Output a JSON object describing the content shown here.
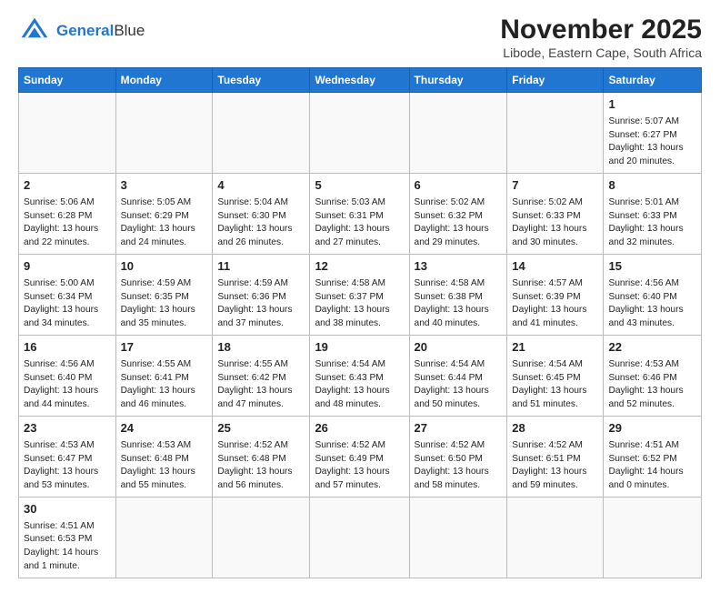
{
  "header": {
    "logo_line1": "General",
    "logo_line2": "Blue",
    "title": "November 2025",
    "subtitle": "Libode, Eastern Cape, South Africa"
  },
  "days_of_week": [
    "Sunday",
    "Monday",
    "Tuesday",
    "Wednesday",
    "Thursday",
    "Friday",
    "Saturday"
  ],
  "weeks": [
    [
      {
        "day": "",
        "info": ""
      },
      {
        "day": "",
        "info": ""
      },
      {
        "day": "",
        "info": ""
      },
      {
        "day": "",
        "info": ""
      },
      {
        "day": "",
        "info": ""
      },
      {
        "day": "",
        "info": ""
      },
      {
        "day": "1",
        "info": "Sunrise: 5:07 AM\nSunset: 6:27 PM\nDaylight: 13 hours and 20 minutes."
      }
    ],
    [
      {
        "day": "2",
        "info": "Sunrise: 5:06 AM\nSunset: 6:28 PM\nDaylight: 13 hours and 22 minutes."
      },
      {
        "day": "3",
        "info": "Sunrise: 5:05 AM\nSunset: 6:29 PM\nDaylight: 13 hours and 24 minutes."
      },
      {
        "day": "4",
        "info": "Sunrise: 5:04 AM\nSunset: 6:30 PM\nDaylight: 13 hours and 26 minutes."
      },
      {
        "day": "5",
        "info": "Sunrise: 5:03 AM\nSunset: 6:31 PM\nDaylight: 13 hours and 27 minutes."
      },
      {
        "day": "6",
        "info": "Sunrise: 5:02 AM\nSunset: 6:32 PM\nDaylight: 13 hours and 29 minutes."
      },
      {
        "day": "7",
        "info": "Sunrise: 5:02 AM\nSunset: 6:33 PM\nDaylight: 13 hours and 30 minutes."
      },
      {
        "day": "8",
        "info": "Sunrise: 5:01 AM\nSunset: 6:33 PM\nDaylight: 13 hours and 32 minutes."
      }
    ],
    [
      {
        "day": "9",
        "info": "Sunrise: 5:00 AM\nSunset: 6:34 PM\nDaylight: 13 hours and 34 minutes."
      },
      {
        "day": "10",
        "info": "Sunrise: 4:59 AM\nSunset: 6:35 PM\nDaylight: 13 hours and 35 minutes."
      },
      {
        "day": "11",
        "info": "Sunrise: 4:59 AM\nSunset: 6:36 PM\nDaylight: 13 hours and 37 minutes."
      },
      {
        "day": "12",
        "info": "Sunrise: 4:58 AM\nSunset: 6:37 PM\nDaylight: 13 hours and 38 minutes."
      },
      {
        "day": "13",
        "info": "Sunrise: 4:58 AM\nSunset: 6:38 PM\nDaylight: 13 hours and 40 minutes."
      },
      {
        "day": "14",
        "info": "Sunrise: 4:57 AM\nSunset: 6:39 PM\nDaylight: 13 hours and 41 minutes."
      },
      {
        "day": "15",
        "info": "Sunrise: 4:56 AM\nSunset: 6:40 PM\nDaylight: 13 hours and 43 minutes."
      }
    ],
    [
      {
        "day": "16",
        "info": "Sunrise: 4:56 AM\nSunset: 6:40 PM\nDaylight: 13 hours and 44 minutes."
      },
      {
        "day": "17",
        "info": "Sunrise: 4:55 AM\nSunset: 6:41 PM\nDaylight: 13 hours and 46 minutes."
      },
      {
        "day": "18",
        "info": "Sunrise: 4:55 AM\nSunset: 6:42 PM\nDaylight: 13 hours and 47 minutes."
      },
      {
        "day": "19",
        "info": "Sunrise: 4:54 AM\nSunset: 6:43 PM\nDaylight: 13 hours and 48 minutes."
      },
      {
        "day": "20",
        "info": "Sunrise: 4:54 AM\nSunset: 6:44 PM\nDaylight: 13 hours and 50 minutes."
      },
      {
        "day": "21",
        "info": "Sunrise: 4:54 AM\nSunset: 6:45 PM\nDaylight: 13 hours and 51 minutes."
      },
      {
        "day": "22",
        "info": "Sunrise: 4:53 AM\nSunset: 6:46 PM\nDaylight: 13 hours and 52 minutes."
      }
    ],
    [
      {
        "day": "23",
        "info": "Sunrise: 4:53 AM\nSunset: 6:47 PM\nDaylight: 13 hours and 53 minutes."
      },
      {
        "day": "24",
        "info": "Sunrise: 4:53 AM\nSunset: 6:48 PM\nDaylight: 13 hours and 55 minutes."
      },
      {
        "day": "25",
        "info": "Sunrise: 4:52 AM\nSunset: 6:48 PM\nDaylight: 13 hours and 56 minutes."
      },
      {
        "day": "26",
        "info": "Sunrise: 4:52 AM\nSunset: 6:49 PM\nDaylight: 13 hours and 57 minutes."
      },
      {
        "day": "27",
        "info": "Sunrise: 4:52 AM\nSunset: 6:50 PM\nDaylight: 13 hours and 58 minutes."
      },
      {
        "day": "28",
        "info": "Sunrise: 4:52 AM\nSunset: 6:51 PM\nDaylight: 13 hours and 59 minutes."
      },
      {
        "day": "29",
        "info": "Sunrise: 4:51 AM\nSunset: 6:52 PM\nDaylight: 14 hours and 0 minutes."
      }
    ],
    [
      {
        "day": "30",
        "info": "Sunrise: 4:51 AM\nSunset: 6:53 PM\nDaylight: 14 hours and 1 minute."
      },
      {
        "day": "",
        "info": ""
      },
      {
        "day": "",
        "info": ""
      },
      {
        "day": "",
        "info": ""
      },
      {
        "day": "",
        "info": ""
      },
      {
        "day": "",
        "info": ""
      },
      {
        "day": "",
        "info": ""
      }
    ]
  ]
}
